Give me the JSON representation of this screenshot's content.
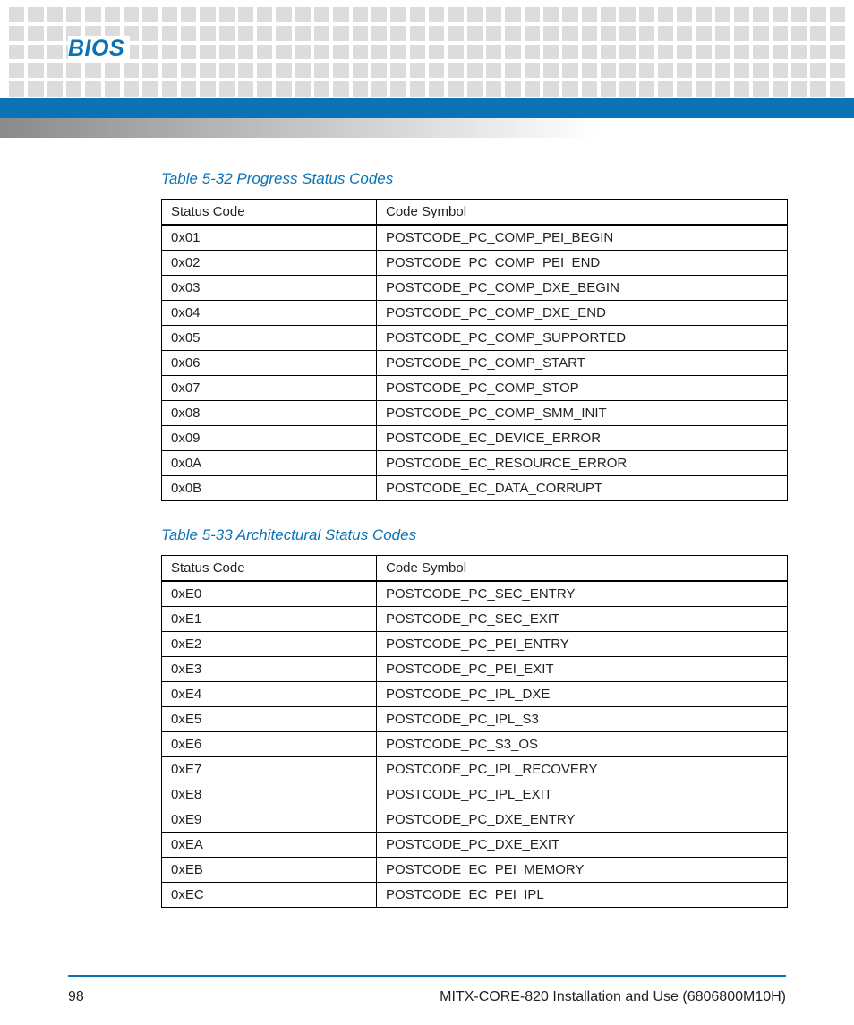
{
  "section_title": "BIOS",
  "table1": {
    "caption": "Table 5-32 Progress Status Codes",
    "headers": [
      "Status Code",
      "Code Symbol"
    ],
    "rows": [
      [
        "0x01",
        "POSTCODE_PC_COMP_PEI_BEGIN"
      ],
      [
        "0x02",
        "POSTCODE_PC_COMP_PEI_END"
      ],
      [
        "0x03",
        "POSTCODE_PC_COMP_DXE_BEGIN"
      ],
      [
        "0x04",
        "POSTCODE_PC_COMP_DXE_END"
      ],
      [
        "0x05",
        "POSTCODE_PC_COMP_SUPPORTED"
      ],
      [
        "0x06",
        "POSTCODE_PC_COMP_START"
      ],
      [
        "0x07",
        "POSTCODE_PC_COMP_STOP"
      ],
      [
        "0x08",
        "POSTCODE_PC_COMP_SMM_INIT"
      ],
      [
        "0x09",
        "POSTCODE_EC_DEVICE_ERROR"
      ],
      [
        "0x0A",
        "POSTCODE_EC_RESOURCE_ERROR"
      ],
      [
        "0x0B",
        "POSTCODE_EC_DATA_CORRUPT"
      ]
    ]
  },
  "table2": {
    "caption": "Table 5-33 Architectural Status Codes",
    "headers": [
      "Status Code",
      "Code Symbol"
    ],
    "rows": [
      [
        "0xE0",
        "POSTCODE_PC_SEC_ENTRY"
      ],
      [
        "0xE1",
        "POSTCODE_PC_SEC_EXIT"
      ],
      [
        "0xE2",
        "POSTCODE_PC_PEI_ENTRY"
      ],
      [
        "0xE3",
        "POSTCODE_PC_PEI_EXIT"
      ],
      [
        "0xE4",
        "POSTCODE_PC_IPL_DXE"
      ],
      [
        "0xE5",
        "POSTCODE_PC_IPL_S3"
      ],
      [
        "0xE6",
        "POSTCODE_PC_S3_OS"
      ],
      [
        "0xE7",
        "POSTCODE_PC_IPL_RECOVERY"
      ],
      [
        "0xE8",
        "POSTCODE_PC_IPL_EXIT"
      ],
      [
        "0xE9",
        "POSTCODE_PC_DXE_ENTRY"
      ],
      [
        "0xEA",
        "POSTCODE_PC_DXE_EXIT"
      ],
      [
        "0xEB",
        "POSTCODE_EC_PEI_MEMORY"
      ],
      [
        "0xEC",
        "POSTCODE_EC_PEI_IPL"
      ]
    ]
  },
  "footer": {
    "page": "98",
    "doc": "MITX-CORE-820 Installation and Use (6806800M10H)"
  }
}
